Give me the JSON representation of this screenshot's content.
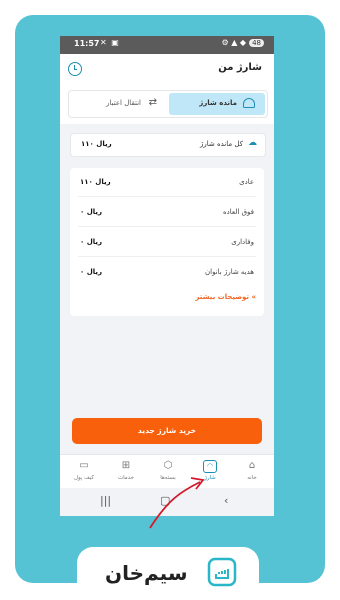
{
  "status_bar": {
    "time": "11:57",
    "battery": "48"
  },
  "header": {
    "title": "شارژ من"
  },
  "tabs": [
    {
      "label": "مانده شارژ",
      "active": true
    },
    {
      "label": "انتقال اعتبار",
      "active": false
    }
  ],
  "total": {
    "label": "کل مانده شارژ",
    "value": "۱۱۰ ریال"
  },
  "rows": [
    {
      "label": "عادی",
      "value": "۱۱۰ ریال"
    },
    {
      "label": "فوق العاده",
      "value": "۰ ریال"
    },
    {
      "label": "وفاداری",
      "value": "۰ ریال"
    },
    {
      "label": "هدیه شارژ بانوان",
      "value": "۰ ریال"
    }
  ],
  "more_link": "توضیحات بیشتر «",
  "cta": {
    "label": "خرید شارژ جدید"
  },
  "bottom_nav": [
    {
      "label": "خانه",
      "icon": "home-icon"
    },
    {
      "label": "شارژ",
      "icon": "charge-icon",
      "active": true
    },
    {
      "label": "بسته‌ها",
      "icon": "package-icon"
    },
    {
      "label": "خدمات",
      "icon": "services-icon"
    },
    {
      "label": "کیف پول",
      "icon": "wallet-icon"
    }
  ],
  "logo": {
    "text": "سیم‌خان"
  },
  "colors": {
    "frame": "#56c3d4",
    "accent": "#1d8fb0",
    "cta": "#f8600c",
    "arrow": "#d41a2a"
  }
}
